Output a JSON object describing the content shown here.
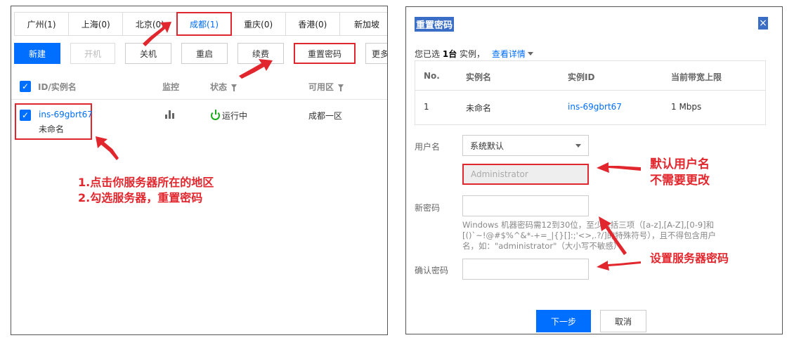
{
  "left": {
    "region_tabs": [
      {
        "label": "广州(1)",
        "active": false
      },
      {
        "label": "上海(0)",
        "active": false
      },
      {
        "label": "北京(0)",
        "active": false
      },
      {
        "label": "成都(1)",
        "active": true
      },
      {
        "label": "重庆(0)",
        "active": false
      },
      {
        "label": "香港(0)",
        "active": false
      },
      {
        "label": "新加坡",
        "active": false
      }
    ],
    "toolbar": {
      "new_label": "新建",
      "start_label": "开机",
      "shutdown_label": "关机",
      "restart_label": "重启",
      "renew_label": "续费",
      "reset_password_label": "重置密码",
      "more_label": "更多操作"
    },
    "table": {
      "columns": {
        "id_name": "ID/实例名",
        "monitor": "监控",
        "status": "状态",
        "zone": "可用区"
      },
      "row": {
        "instance_id": "ins-69gbrt67",
        "instance_name": "未命名",
        "status": "运行中",
        "zone": "成都一区"
      }
    },
    "annotation": {
      "line1": "1.点击你服务器所在的地区",
      "line2": "2.勾选服务器，重置密码"
    }
  },
  "right": {
    "title": "重置密码",
    "close_glyph": "×",
    "selected_prefix": "您已选",
    "selected_count": "1台",
    "selected_suffix": "实例，",
    "details_link": "查看详情",
    "instance_table": {
      "headers": [
        "No.",
        "实例名",
        "实例ID",
        "当前带宽上限"
      ],
      "row": [
        "1",
        "未命名",
        "ins-69gbrt67",
        "1 Mbps"
      ]
    },
    "form": {
      "username_label": "用户名",
      "username_select": "系统默认",
      "username_value": "Administrator",
      "new_password_label": "新密码",
      "new_password_value": "",
      "password_hint": "Windows 机器密码需12到30位，至少包括三项（[a-z],[A-Z],[0-9]和[()`~!@#$%^&*-+=_|{}[]:;'<>,.?/]的特殊符号），且不得包含用户名，如：\"administrator\"（大小写不敏感）",
      "confirm_password_label": "确认密码",
      "confirm_password_value": ""
    },
    "buttons": {
      "next": "下一步",
      "cancel": "取消"
    },
    "annotation_username": {
      "line1": "默认用户名",
      "line2": "不需要更改"
    },
    "annotation_password": "设置服务器密码"
  },
  "colors": {
    "accent": "#006eff",
    "annotation_red": "#e1262d",
    "status_green": "#1aac19",
    "title_highlight": "#3a6ec6"
  }
}
